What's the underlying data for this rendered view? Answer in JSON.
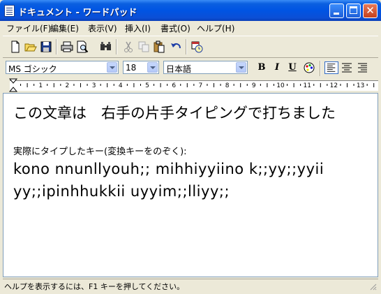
{
  "window": {
    "title": "ドキュメント - ワードパッド"
  },
  "menu": [
    {
      "label": "ファイル(F)"
    },
    {
      "label": "編集(E)"
    },
    {
      "label": "表示(V)"
    },
    {
      "label": "挿入(I)"
    },
    {
      "label": "書式(O)"
    },
    {
      "label": "ヘルプ(H)"
    }
  ],
  "toolbar": {
    "icons": [
      "new-icon",
      "open-icon",
      "save-icon",
      "print-icon",
      "print-preview-icon",
      "find-icon",
      "cut-icon",
      "copy-icon",
      "paste-icon",
      "undo-icon",
      "date-time-icon"
    ]
  },
  "format": {
    "font": "MS ゴシック",
    "size": "18",
    "script": "日本語",
    "bold": "B",
    "italic": "I",
    "underline": "U"
  },
  "ruler": {
    "numbers": [
      "1",
      "2",
      "3",
      "4",
      "5",
      "6",
      "7",
      "8",
      "9",
      "10",
      "11",
      "12",
      "13"
    ]
  },
  "document": {
    "lines": [
      "この文章は　右手の片手タイピングで打ちました",
      "実際にタイプしたキー(変換キーをのぞく):",
      "kono nnunllyouh;; mihhiyyiino k;;yy;;yyii",
      "yy;;ipinhhukkii uyyim;;lliyy;;"
    ]
  },
  "status": {
    "text": "ヘルプを表示するには、F1 キーを押してください。"
  },
  "colors": {
    "titlebar": "#0054e3",
    "chrome": "#ece9d8",
    "close": "#c6401d"
  }
}
